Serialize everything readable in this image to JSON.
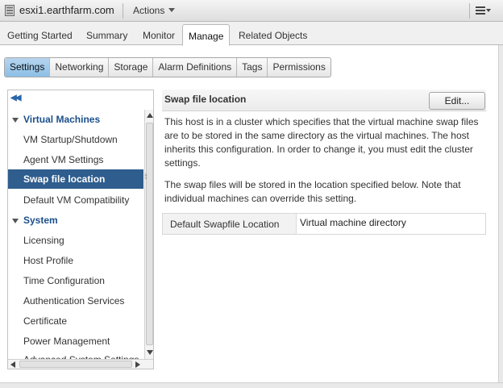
{
  "titlebar": {
    "host_name": "esxi1.earthfarm.com",
    "actions_label": "Actions"
  },
  "main_tabs": [
    {
      "label": "Getting Started"
    },
    {
      "label": "Summary"
    },
    {
      "label": "Monitor"
    },
    {
      "label": "Manage",
      "active": true
    },
    {
      "label": "Related Objects"
    }
  ],
  "sub_tabs": [
    {
      "label": "Settings",
      "active": true
    },
    {
      "label": "Networking"
    },
    {
      "label": "Storage"
    },
    {
      "label": "Alarm Definitions"
    },
    {
      "label": "Tags"
    },
    {
      "label": "Permissions"
    }
  ],
  "nav": {
    "groups": [
      {
        "label": "Virtual Machines",
        "items": [
          "VM Startup/Shutdown",
          "Agent VM Settings",
          "Swap file location",
          "Default VM Compatibility"
        ]
      },
      {
        "label": "System",
        "items": [
          "Licensing",
          "Host Profile",
          "Time Configuration",
          "Authentication Services",
          "Certificate",
          "Power Management",
          "Advanced System Settings"
        ]
      }
    ],
    "selected": "Swap file location"
  },
  "content": {
    "title": "Swap file location",
    "edit_label": "Edit...",
    "paragraph1": "This host is in a cluster which specifies that the virtual machine swap files are to be stored in the same directory as the virtual machines. The host inherits this configuration. In order to change it, you must edit the cluster settings.",
    "paragraph2": "The swap files will be stored in the location specified below. Note that individual machines can override this setting.",
    "setting_label": "Default Swapfile Location",
    "setting_value": "Virtual machine directory"
  },
  "colors": {
    "selected_nav": "#2e5d8e",
    "group_text": "#1b4f8a",
    "active_subtab": "#8cbfe6"
  }
}
